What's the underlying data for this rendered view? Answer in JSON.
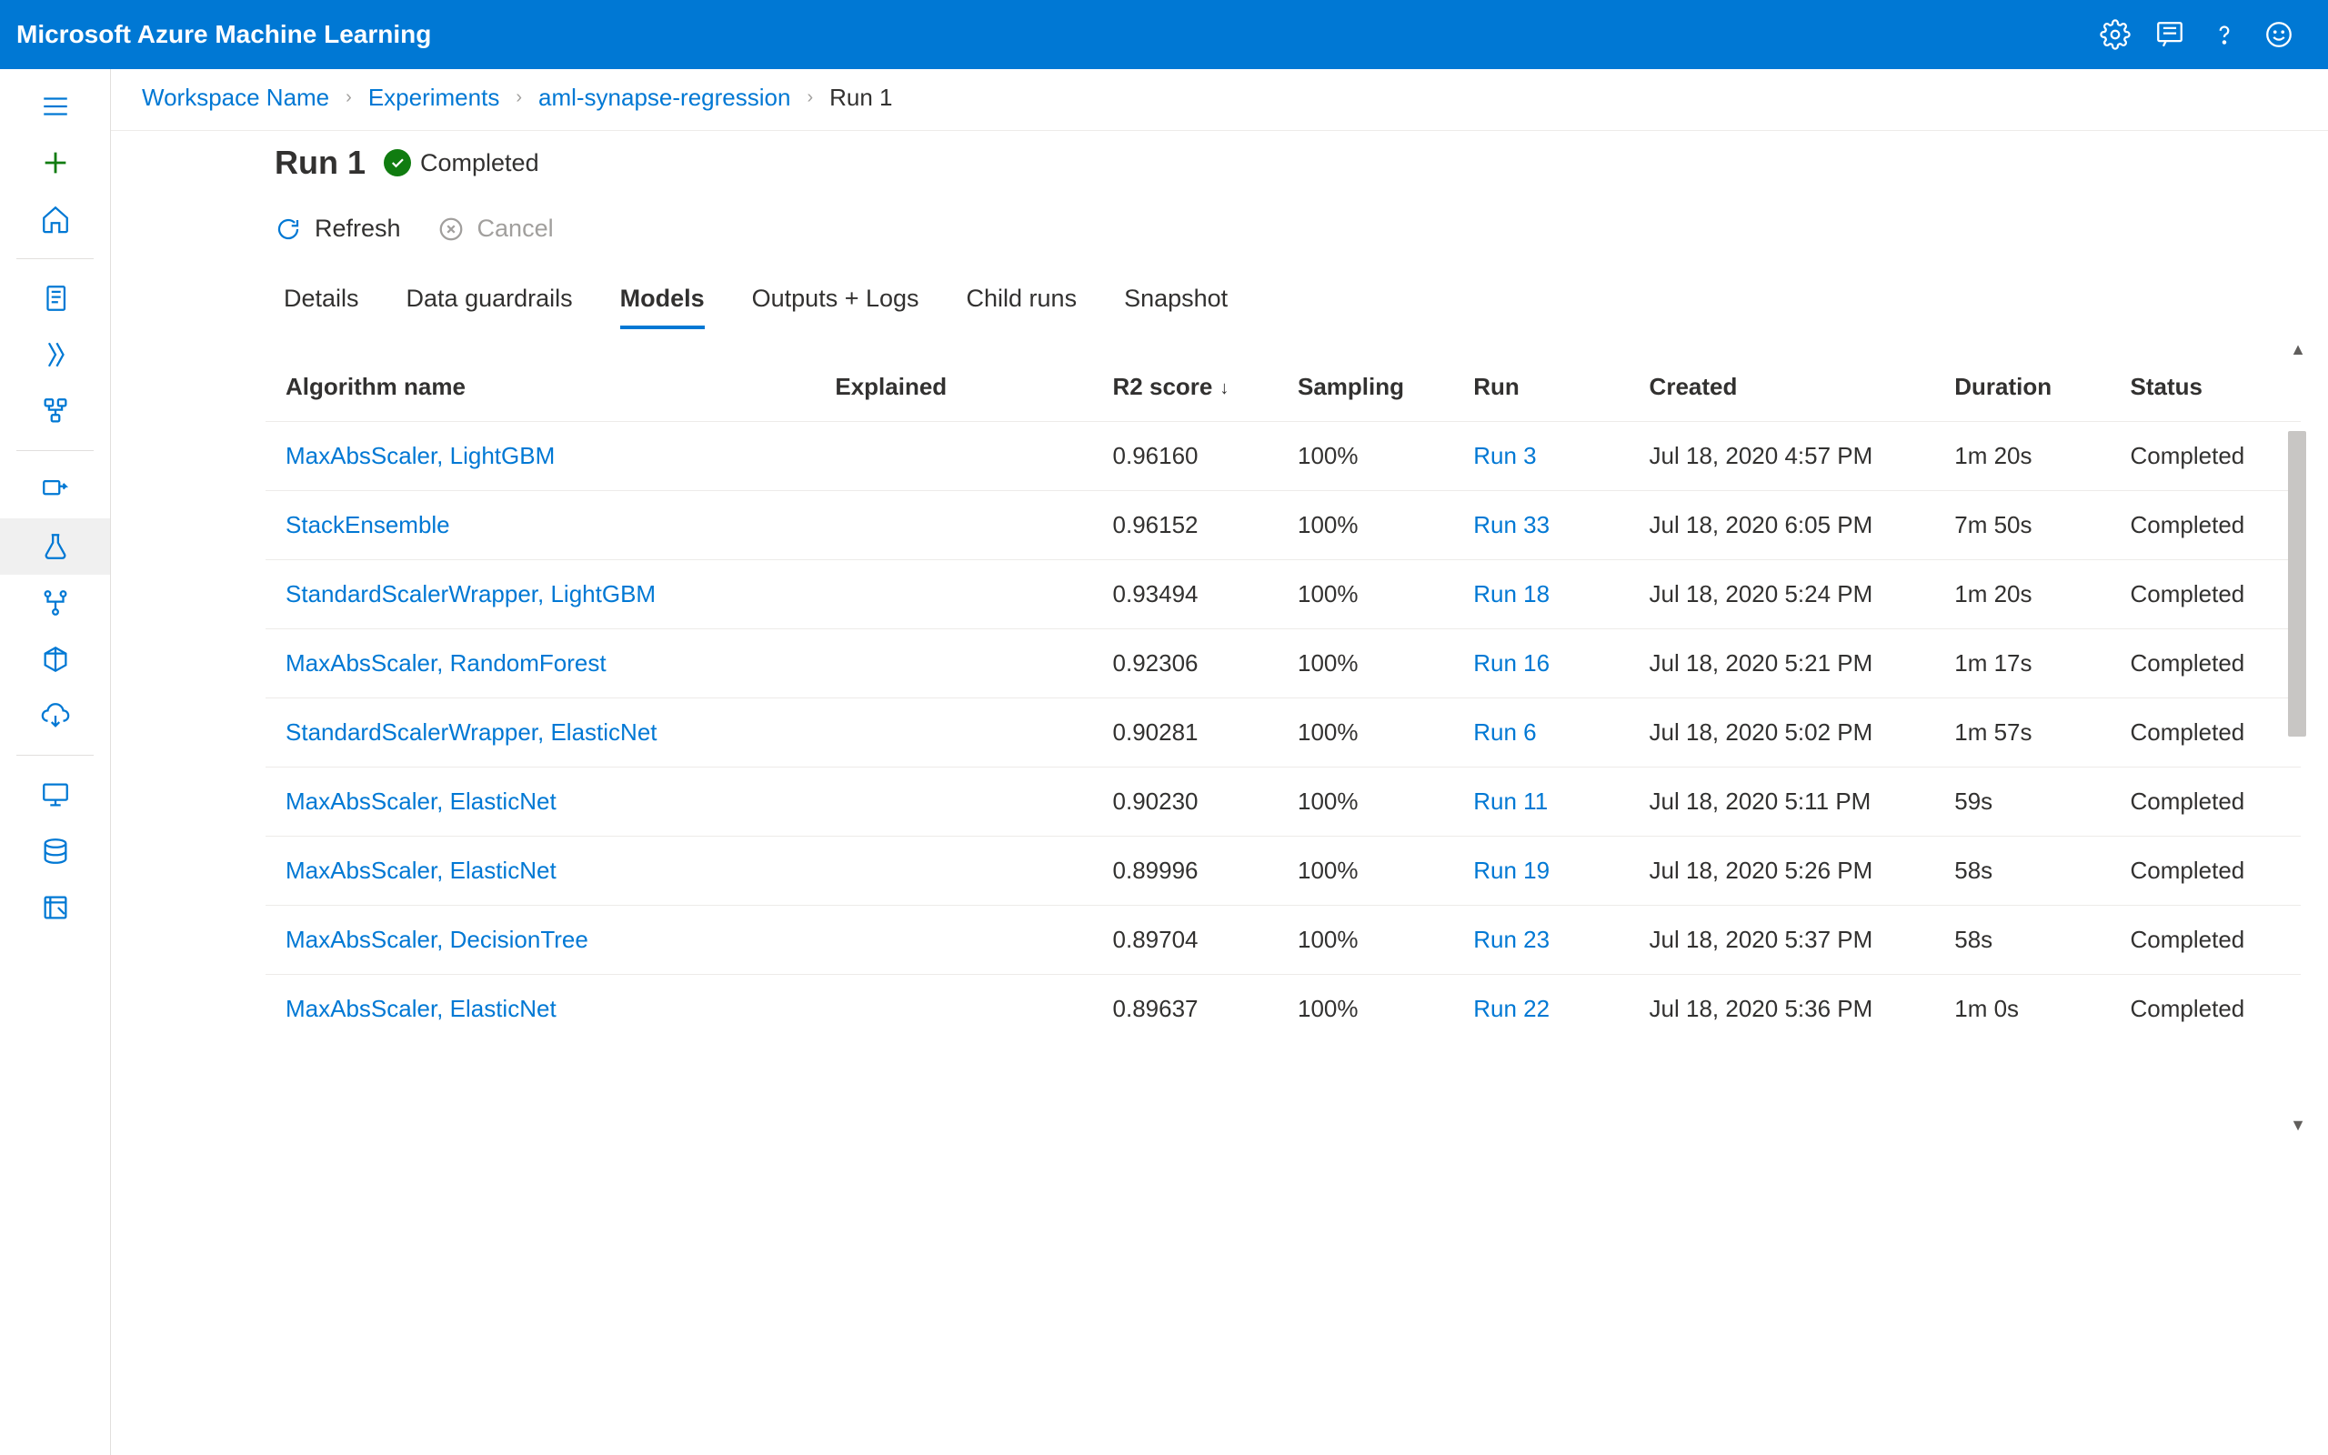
{
  "app_title": "Microsoft Azure Machine Learning",
  "breadcrumb": {
    "workspace": "Workspace Name",
    "experiments": "Experiments",
    "experiment_name": "aml-synapse-regression",
    "run": "Run 1"
  },
  "header": {
    "title": "Run 1",
    "status": "Completed"
  },
  "actions": {
    "refresh": "Refresh",
    "cancel": "Cancel"
  },
  "tabs": [
    "Details",
    "Data guardrails",
    "Models",
    "Outputs + Logs",
    "Child runs",
    "Snapshot"
  ],
  "active_tab": "Models",
  "columns": {
    "algo": "Algorithm name",
    "explained": "Explained",
    "r2": "R2 score",
    "sampling": "Sampling",
    "run": "Run",
    "created": "Created",
    "duration": "Duration",
    "status": "Status"
  },
  "sort_indicator": "↓",
  "rows": [
    {
      "algo": "MaxAbsScaler, LightGBM",
      "explained": "",
      "r2": "0.96160",
      "sampling": "100%",
      "run": "Run 3",
      "created": "Jul 18, 2020 4:57 PM",
      "duration": "1m 20s",
      "status": "Completed"
    },
    {
      "algo": "StackEnsemble",
      "explained": "",
      "r2": "0.96152",
      "sampling": "100%",
      "run": "Run 33",
      "created": "Jul 18, 2020 6:05 PM",
      "duration": "7m 50s",
      "status": "Completed"
    },
    {
      "algo": "StandardScalerWrapper, LightGBM",
      "explained": "",
      "r2": "0.93494",
      "sampling": "100%",
      "run": "Run 18",
      "created": "Jul 18, 2020 5:24 PM",
      "duration": "1m 20s",
      "status": "Completed"
    },
    {
      "algo": "MaxAbsScaler, RandomForest",
      "explained": "",
      "r2": "0.92306",
      "sampling": "100%",
      "run": "Run 16",
      "created": "Jul 18, 2020 5:21 PM",
      "duration": "1m 17s",
      "status": "Completed"
    },
    {
      "algo": "StandardScalerWrapper, ElasticNet",
      "explained": "",
      "r2": "0.90281",
      "sampling": "100%",
      "run": "Run 6",
      "created": "Jul 18, 2020 5:02 PM",
      "duration": "1m 57s",
      "status": "Completed"
    },
    {
      "algo": "MaxAbsScaler, ElasticNet",
      "explained": "",
      "r2": "0.90230",
      "sampling": "100%",
      "run": "Run 11",
      "created": "Jul 18, 2020 5:11 PM",
      "duration": "59s",
      "status": "Completed"
    },
    {
      "algo": "MaxAbsScaler, ElasticNet",
      "explained": "",
      "r2": "0.89996",
      "sampling": "100%",
      "run": "Run 19",
      "created": "Jul 18, 2020 5:26 PM",
      "duration": "58s",
      "status": "Completed"
    },
    {
      "algo": "MaxAbsScaler, DecisionTree",
      "explained": "",
      "r2": "0.89704",
      "sampling": "100%",
      "run": "Run 23",
      "created": "Jul 18, 2020 5:37 PM",
      "duration": "58s",
      "status": "Completed"
    },
    {
      "algo": "MaxAbsScaler, ElasticNet",
      "explained": "",
      "r2": "0.89637",
      "sampling": "100%",
      "run": "Run 22",
      "created": "Jul 18, 2020 5:36 PM",
      "duration": "1m 0s",
      "status": "Completed"
    }
  ]
}
